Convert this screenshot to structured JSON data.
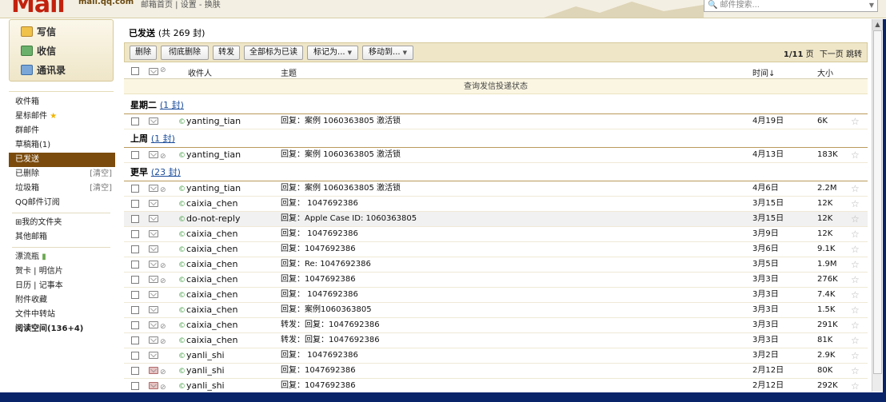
{
  "top": {
    "domain": "mail.qq.com",
    "links": [
      "邮箱首页",
      "设置",
      "换肤"
    ],
    "search_placeholder": "邮件搜索..."
  },
  "sidebar": {
    "compose": "写信",
    "inbox_quick": "收信",
    "contacts": "通讯录",
    "items": [
      {
        "label": "收件箱"
      },
      {
        "label": "星标邮件"
      },
      {
        "label": "群邮件"
      },
      {
        "label": "草稿箱(1)"
      },
      {
        "label": "已发送"
      },
      {
        "label": "已删除",
        "action": "[清空]"
      },
      {
        "label": "垃圾箱",
        "action": "[清空]"
      },
      {
        "label": "QQ邮件订阅"
      },
      {
        "label": "⊞我的文件夹"
      },
      {
        "label": "其他邮箱"
      },
      {
        "label": "漂流瓶"
      },
      {
        "label": "贺卡 | 明信片"
      },
      {
        "label": "日历 | 记事本"
      },
      {
        "label": "附件收藏"
      },
      {
        "label": "文件中转站"
      },
      {
        "label": "阅读空间(136+4)"
      }
    ]
  },
  "main": {
    "folder": "已发送",
    "count": "(共 269 封)",
    "toolbar": {
      "delete": "删除",
      "delete_perm": "彻底删除",
      "forward": "转发",
      "mark_all_read": "全部标为已读",
      "mark_as": "标记为...",
      "move_to": "移动到..."
    },
    "pager": {
      "current": "1/11",
      "page": "页",
      "next": "下一页",
      "jump": "跳转"
    },
    "columns": {
      "recipient": "收件人",
      "subject": "主题",
      "time": "时间↓",
      "size": "大小"
    },
    "notice": "查询发信投递状态",
    "groups": [
      {
        "title": "星期二",
        "count": "(1 封)"
      },
      {
        "title": "上周",
        "count": "(1 封)"
      },
      {
        "title": "更早",
        "count": "(23 封)"
      }
    ],
    "rows": [
      {
        "recipient": "yanting_tian",
        "subject": "回复：案例 1060363805 激活锁",
        "date": "4月19日",
        "size": "6K"
      },
      {
        "recipient": "yanting_tian",
        "subject": "回复：案例 1060363805 激活锁",
        "date": "4月13日",
        "size": "183K"
      },
      {
        "recipient": "yanting_tian",
        "subject": "回复：案例 1060363805 激活锁",
        "date": "4月6日",
        "size": "2.2M"
      },
      {
        "recipient": "caixia_chen",
        "subject": "回复：  1047692386",
        "date": "3月15日",
        "size": "12K"
      },
      {
        "recipient": "do-not-reply",
        "subject": "回复：Apple Case ID: 1060363805",
        "date": "3月15日",
        "size": "12K"
      },
      {
        "recipient": "caixia_chen",
        "subject": "回复：  1047692386",
        "date": "3月9日",
        "size": "12K"
      },
      {
        "recipient": "caixia_chen",
        "subject": "回复：1047692386",
        "date": "3月6日",
        "size": "9.1K"
      },
      {
        "recipient": "caixia_chen",
        "subject": "回复：Re: 1047692386",
        "date": "3月5日",
        "size": "1.9M"
      },
      {
        "recipient": "caixia_chen",
        "subject": "回复：1047692386",
        "date": "3月3日",
        "size": "276K"
      },
      {
        "recipient": "caixia_chen",
        "subject": "回复：  1047692386",
        "date": "3月3日",
        "size": "7.4K"
      },
      {
        "recipient": "caixia_chen",
        "subject": "回复：案例1060363805",
        "date": "3月3日",
        "size": "1.5K"
      },
      {
        "recipient": "caixia_chen",
        "subject": "转发：回复：1047692386",
        "date": "3月3日",
        "size": "291K"
      },
      {
        "recipient": "caixia_chen",
        "subject": "转发：回复：1047692386",
        "date": "3月3日",
        "size": "81K"
      },
      {
        "recipient": "yanli_shi",
        "subject": "回复：  1047692386",
        "date": "3月2日",
        "size": "2.9K"
      },
      {
        "recipient": "yanli_shi",
        "subject": "回复：1047692386",
        "date": "2月12日",
        "size": "80K"
      },
      {
        "recipient": "yanli_shi",
        "subject": "回复：1047692386",
        "date": "2月12日",
        "size": "292K"
      }
    ]
  }
}
